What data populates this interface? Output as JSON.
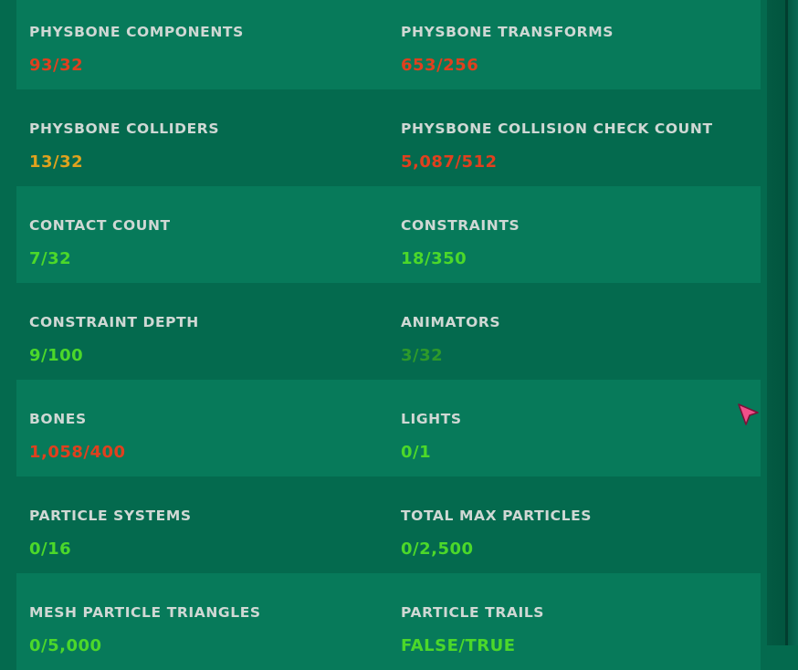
{
  "colors": {
    "bad": "#e0401e",
    "warn": "#e0a21e",
    "good": "#4cd82a",
    "muted": "#2e9a2a",
    "label": "#cfd8d4",
    "row_light": "#077a5a",
    "row_dark": "#046a4e"
  },
  "stats": [
    [
      {
        "label": "PHYSBONE COMPONENTS",
        "value": "93/32",
        "status": "bad"
      },
      {
        "label": "PHYSBONE TRANSFORMS",
        "value": "653/256",
        "status": "bad"
      }
    ],
    [
      {
        "label": "PHYSBONE COLLIDERS",
        "value": "13/32",
        "status": "warn"
      },
      {
        "label": "PHYSBONE COLLISION CHECK COUNT",
        "value": "5,087/512",
        "status": "bad"
      }
    ],
    [
      {
        "label": "CONTACT COUNT",
        "value": "7/32",
        "status": "good"
      },
      {
        "label": "CONSTRAINTS",
        "value": "18/350",
        "status": "good"
      }
    ],
    [
      {
        "label": "CONSTRAINT DEPTH",
        "value": "9/100",
        "status": "good"
      },
      {
        "label": "ANIMATORS",
        "value": "3/32",
        "status": "muted"
      }
    ],
    [
      {
        "label": "BONES",
        "value": "1,058/400",
        "status": "bad"
      },
      {
        "label": "LIGHTS",
        "value": "0/1",
        "status": "good"
      }
    ],
    [
      {
        "label": "PARTICLE SYSTEMS",
        "value": "0/16",
        "status": "good"
      },
      {
        "label": "TOTAL MAX PARTICLES",
        "value": "0/2,500",
        "status": "good"
      }
    ],
    [
      {
        "label": "MESH PARTICLE TRIANGLES",
        "value": "0/5,000",
        "status": "good"
      },
      {
        "label": "PARTICLE TRAILS",
        "value": "FALSE/TRUE",
        "status": "good"
      }
    ]
  ],
  "cursor_icon": "pointer-cursor-icon"
}
